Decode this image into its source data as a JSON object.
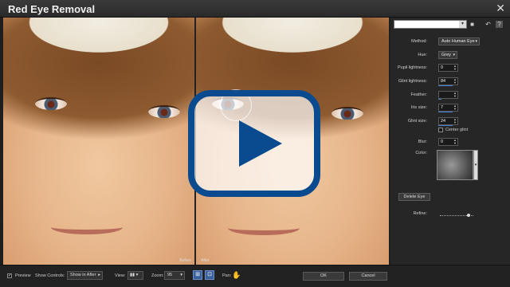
{
  "window": {
    "title": "Red Eye Removal",
    "close_glyph": "✕"
  },
  "preview": {
    "before_label": "Before",
    "after_label": "After"
  },
  "panel": {
    "preset_value": "",
    "method": {
      "label": "Method:",
      "value": "Auto Human Eye"
    },
    "hue": {
      "label": "Hue:",
      "value": "Grey"
    },
    "pupil_lightness": {
      "label": "Pupil lightness:",
      "value": "0"
    },
    "glint_lightness": {
      "label": "Glint lightness:",
      "value": "84"
    },
    "feather": {
      "label": "Feather:",
      "value": ""
    },
    "iris_size": {
      "label": "Iris size:",
      "value": "7"
    },
    "glint_size": {
      "label": "Glint size:",
      "value": "24"
    },
    "center_glint": {
      "label": "Center glint"
    },
    "blur": {
      "label": "Blur:",
      "value": "0"
    },
    "color": {
      "label": "Color:"
    },
    "delete_eye": "Delete Eye",
    "refine": {
      "label": "Refine:",
      "level": 0.9
    }
  },
  "bottom": {
    "preview_label": "Preview",
    "show_controls_label": "Show Controls:",
    "show_controls_value": "Show in After",
    "view_label": "View:",
    "zoom_label": "Zoom:",
    "zoom_value": "95",
    "pan_label": "Pan:",
    "ok": "OK",
    "cancel": "Cancel"
  },
  "colors": {
    "accent": "#0a4a8f",
    "panel_bg": "#262626",
    "link_underline": "#4a7fd4"
  }
}
